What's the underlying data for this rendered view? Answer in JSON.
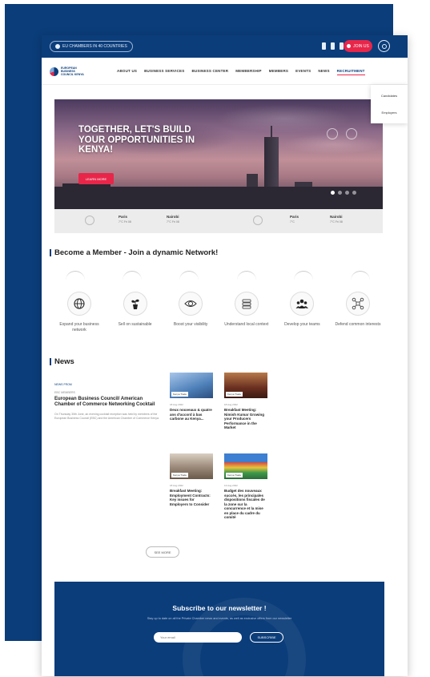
{
  "topbar": {
    "chamber_link": "EU CHAMBERS IN 40 COUNTRIES",
    "join_label": "JOIN US"
  },
  "nav": {
    "logo_text": "EUROPEAN BUSINESS COUNCIL KENYA",
    "items": [
      {
        "label": "ABOUT US"
      },
      {
        "label": "BUSINESS SERVICES"
      },
      {
        "label": "BUSINESS CENTER"
      },
      {
        "label": "MEMBERSHIP"
      },
      {
        "label": "MEMBERS"
      },
      {
        "label": "EVENTS"
      },
      {
        "label": "NEWS"
      },
      {
        "label": "RECRUITMENT",
        "active": true
      }
    ],
    "dropdown": [
      "Candidates",
      "Employers"
    ]
  },
  "hero": {
    "title": "TOGETHER, LET'S BUILD YOUR OPPORTUNITIES IN KENYA!",
    "cta": "LEARN MORE"
  },
  "weather": [
    {
      "city": "Paris",
      "info": "7°C Fri 08"
    },
    {
      "city": "Nairobi",
      "info": "7°C Fri 08"
    },
    {
      "city": "Paris",
      "info": "7°C"
    },
    {
      "city": "Nairobi",
      "info": "7°C Fri 08"
    }
  ],
  "membership": {
    "title": "Become a Member - Join a dynamic Network!",
    "benefits": [
      {
        "label": "Expand your business network",
        "icon": "globe-icon"
      },
      {
        "label": "Sell on sustainable",
        "icon": "plant-icon"
      },
      {
        "label": "Boost your visibility",
        "icon": "eye-icon"
      },
      {
        "label": "Understand local context",
        "icon": "stack-icon"
      },
      {
        "label": "Develop your teams",
        "icon": "team-icon"
      },
      {
        "label": "Defend common interests",
        "icon": "network-icon"
      }
    ]
  },
  "news": {
    "title": "News",
    "featured": {
      "tag": "NEWS FROM",
      "date": "EBC MEMBERS",
      "title": "European Business Council/ American Chamber of Commerce Networking Cocktail",
      "excerpt": "On Thursday 30th June, an evening cocktail reception was held by members of the European Business Council (EBC) and the American Chamber of Commerce Kenya."
    },
    "cards": [
      {
        "category": "Kenya Trade",
        "date": "18 Aug 2022",
        "title": "Deux nouveaux & quatre ans d'accord à bas carbone au Kenya...",
        "thumb_color": "#5b8fc7"
      },
      {
        "category": "Kenya Trade",
        "date": "18 Aug 2022",
        "title": "Breakfast Meeting: Nimish Kumar Growing your Producers Performance in the Market",
        "thumb_color": "#7a3f2a"
      },
      {
        "category": "Kenya Trade",
        "date": "18 Aug 2022",
        "title": "Breakfast Meeting: Employment Contracts: Key issues for Employers to Consider",
        "thumb_color": "#8a7a6a"
      },
      {
        "category": "Kenya Trade",
        "date": "13 Aug 2022",
        "title": "Budget des nouveaux succès, les principales dispositions fiscales de la zone sur la concurrence et la mise en place du cadre du comité",
        "thumb_color": "#3f8a4a"
      }
    ],
    "see_more": "SEE MORE"
  },
  "newsletter": {
    "title": "Subscribe to our newsletter !",
    "subtitle": "Stay up to date on all the Private Chamber news and events, as well as exclusive offers from our newsletter",
    "placeholder": "Your email",
    "button": "SUBSCRIBE"
  }
}
